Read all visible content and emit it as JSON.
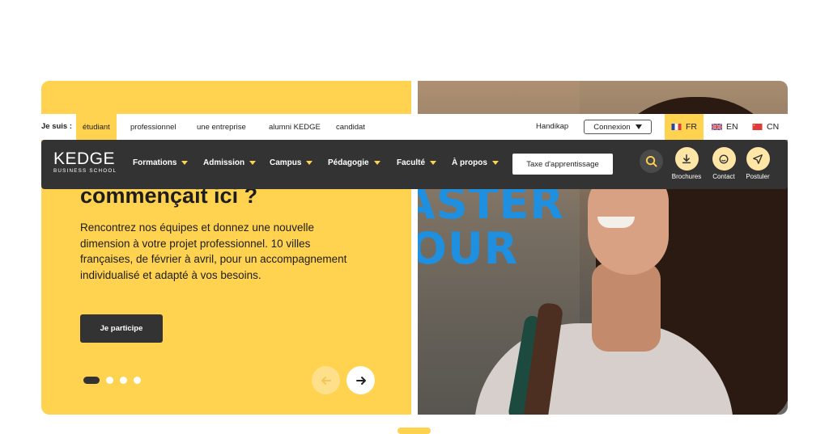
{
  "topbar": {
    "je_suis": "Je suis :",
    "audiences": [
      "étudiant",
      "professionnel",
      "une entreprise",
      "alumni KEDGE",
      "candidat"
    ],
    "handikap": "Handikap",
    "connexion": "Connexion",
    "languages": [
      "FR",
      "EN",
      "CN"
    ]
  },
  "nav": {
    "logo_name": "KEDGE",
    "logo_sub": "BUSINESS SCHOOL",
    "menu": [
      "Formations",
      "Admission",
      "Campus",
      "Pédagogie",
      "Faculté",
      "À propos"
    ],
    "taxe": "Taxe d'apprentissage",
    "tools": [
      "Brochures",
      "Contact",
      "Postuler"
    ]
  },
  "hero": {
    "title": "commençait ici ?",
    "text": "Rencontrez nos équipes et donnez une nouvelle dimension à votre projet professionnel. 10 villes françaises, de février à avril, pour un accompagnement individualisé et adapté à vos besoins.",
    "cta": "Je participe",
    "image_text_1": "ASTER",
    "image_text_2": "OUR"
  },
  "colors": {
    "accent": "#ffd24f",
    "dark": "#333333"
  },
  "icons": [
    "search-icon",
    "download-icon",
    "chat-icon",
    "send-icon",
    "arrow-left-icon",
    "arrow-right-icon",
    "chevron-down-icon"
  ]
}
